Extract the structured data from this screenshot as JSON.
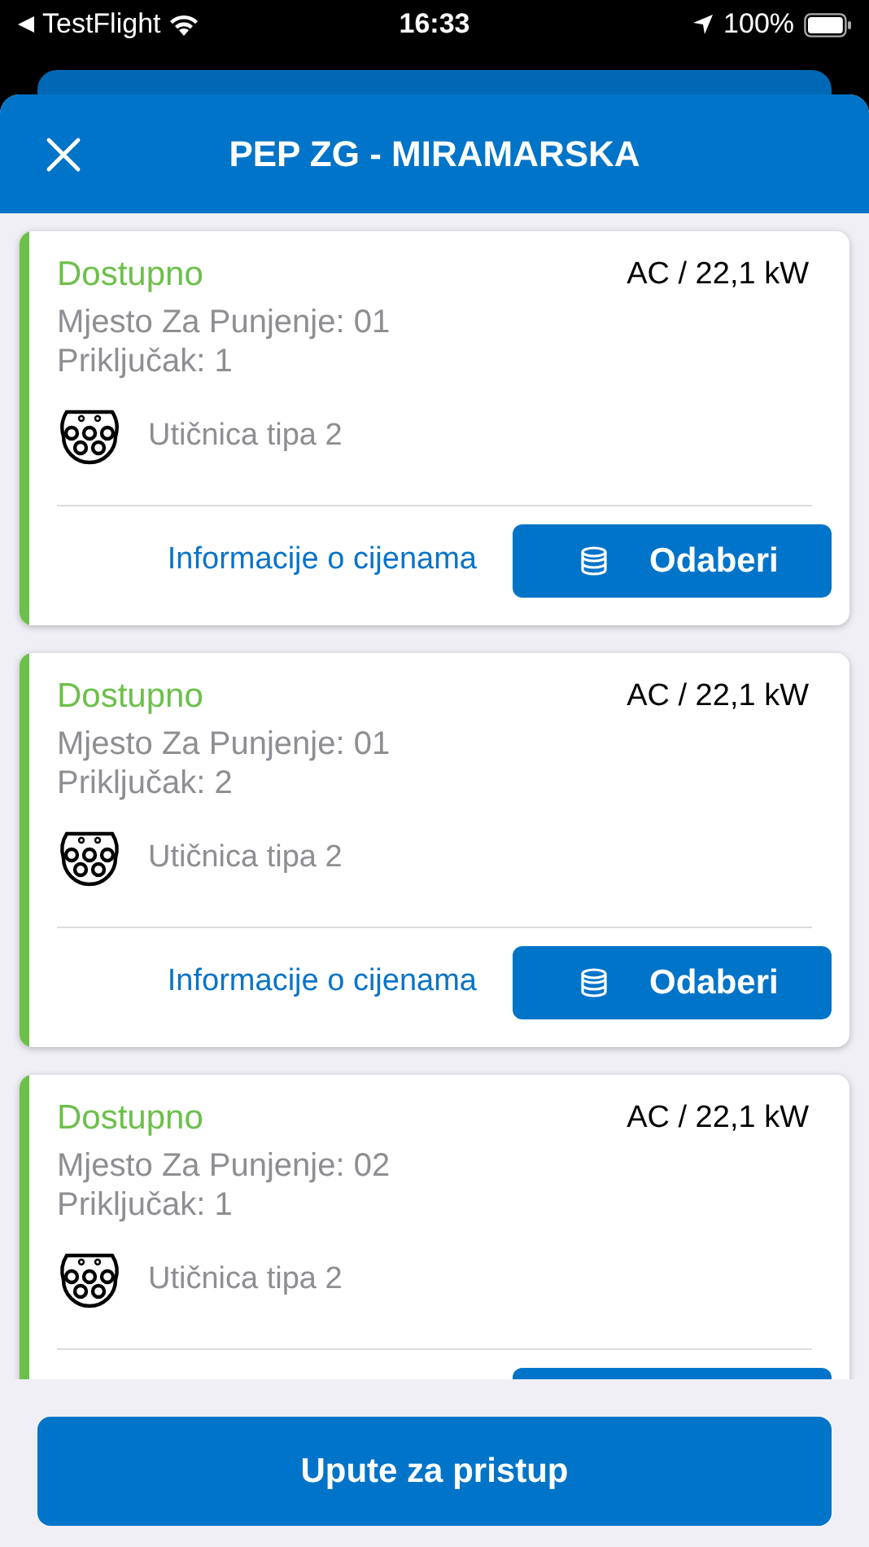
{
  "status_bar": {
    "back_app": "TestFlight",
    "time": "16:33",
    "battery": "100%"
  },
  "header": {
    "title": "PEP ZG - MIRAMARSKA"
  },
  "connectors": [
    {
      "status": "Dostupno",
      "color": "#6cc04a",
      "power": "AC / 22,1 kW",
      "place": "Mjesto Za Punjenje: 01",
      "connector": "Priključak: 1",
      "socket": "Utičnica tipa 2",
      "price_link": "Informacije o cijenama",
      "select_button": "Odaberi"
    },
    {
      "status": "Dostupno",
      "color": "#6cc04a",
      "power": "AC / 22,1 kW",
      "place": "Mjesto Za Punjenje: 01",
      "connector": "Priključak: 2",
      "socket": "Utičnica tipa 2",
      "price_link": "Informacije o cijenama",
      "select_button": "Odaberi"
    },
    {
      "status": "Dostupno",
      "color": "#6cc04a",
      "power": "AC / 22,1 kW",
      "place": "Mjesto Za Punjenje: 02",
      "connector": "Priključak: 1",
      "socket": "Utičnica tipa 2"
    }
  ],
  "footer_button": "Upute za pristup"
}
